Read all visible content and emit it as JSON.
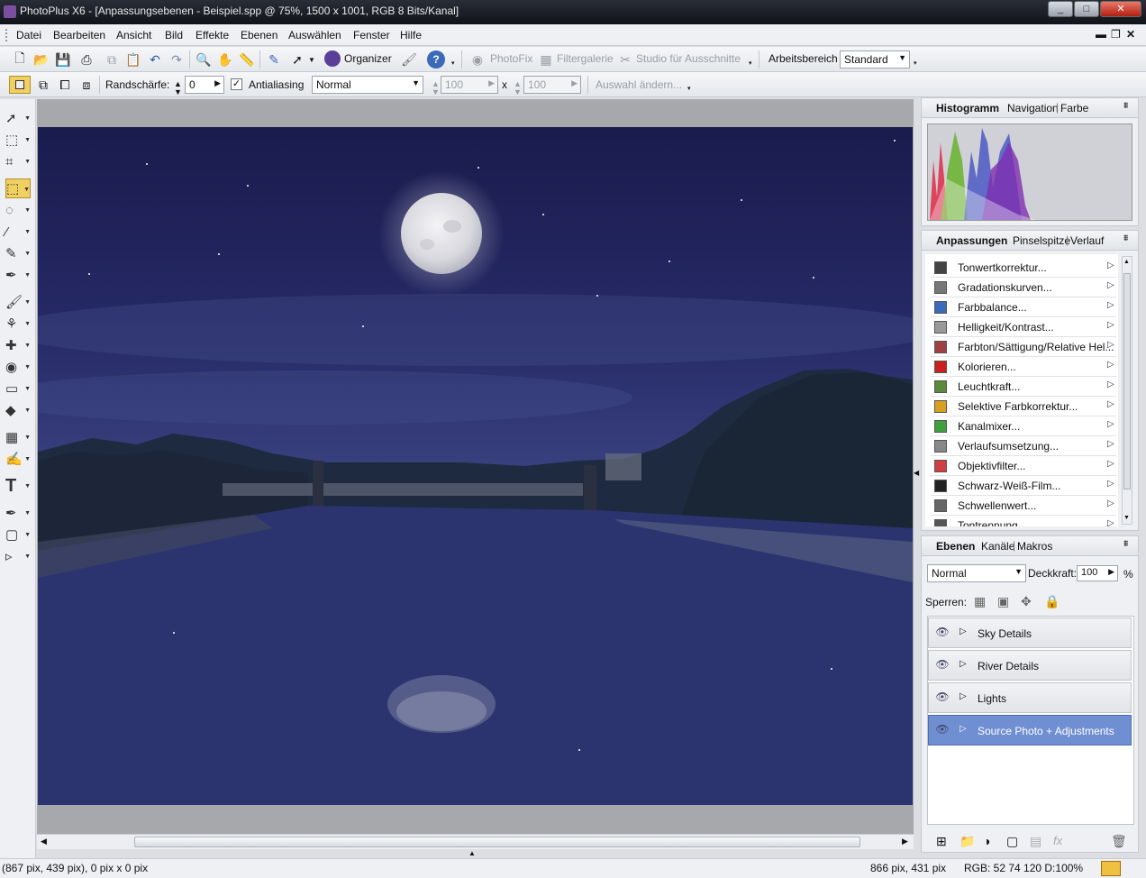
{
  "window": {
    "title": "PhotoPlus X6 - [Anpassungsebenen - Beispiel.spp @ 75%, 1500 x 1001, RGB 8 Bits/Kanal]",
    "controls": [
      "_",
      "□",
      "✕"
    ]
  },
  "menu": [
    "Datei",
    "Bearbeiten",
    "Ansicht",
    "Bild",
    "Effekte",
    "Ebenen",
    "Auswählen",
    "Fenster",
    "Hilfe"
  ],
  "toolbar1": {
    "organizer_label": "Organizer",
    "photofix_label": "PhotoFix",
    "filtergalerie_label": "Filtergalerie",
    "studio_label": "Studio für Ausschnitte",
    "workspace_label": "Arbeitsbereich",
    "workspace_value": "Standard"
  },
  "toolbar2": {
    "randschaerfe_label": "Randschärfe:",
    "randschaerfe_value": "0",
    "antialiasing_label": "Antialiasing",
    "antialiasing_checked": true,
    "mode_value": "Normal",
    "width_value": "100",
    "times": "x",
    "height_value": "100",
    "auswahl_label": "Auswahl ändern..."
  },
  "tools": [
    "move-tool-icon",
    "transform-tool-icon",
    "crop-tool-icon",
    "rect-selection-icon",
    "lasso-icon",
    "magic-wand-icon",
    "selection-brush-icon",
    "color-picker-icon",
    "paintbrush-icon",
    "clone-icon",
    "patch-icon",
    "red-eye-icon",
    "eraser-icon",
    "fill-icon",
    "mesh-warp-icon",
    "smudge-icon",
    "text-icon",
    "pen-icon",
    "shape-icon",
    "node-edit-icon"
  ],
  "histogram_panel": {
    "tabs": [
      "Histogramm",
      "Navigation",
      "Farbe"
    ],
    "active_tab": "Histogramm"
  },
  "adjustments_panel": {
    "tabs": [
      "Anpassungen",
      "Pinselspitze",
      "Verlauf"
    ],
    "active_tab": "Anpassungen",
    "items": [
      {
        "label": "Tonwertkorrektur...",
        "icon": "levels-icon",
        "color": "#444444"
      },
      {
        "label": "Gradationskurven...",
        "icon": "curves-icon",
        "color": "#777777"
      },
      {
        "label": "Farbbalance...",
        "icon": "color-balance-icon",
        "color": "#3a6ab8"
      },
      {
        "label": "Helligkeit/Kontrast...",
        "icon": "brightness-icon",
        "color": "#999999"
      },
      {
        "label": "Farbton/Sättigung/Relative Hel...",
        "icon": "hue-saturation-icon",
        "color": "#a04040"
      },
      {
        "label": "Kolorieren...",
        "icon": "colorize-icon",
        "color": "#cc2020"
      },
      {
        "label": "Leuchtkraft...",
        "icon": "vibrance-icon",
        "color": "#5a8a3a"
      },
      {
        "label": "Selektive Farbkorrektur...",
        "icon": "selective-color-icon",
        "color": "#d8a020"
      },
      {
        "label": "Kanalmixer...",
        "icon": "channel-mixer-icon",
        "color": "#40a040"
      },
      {
        "label": "Verlaufsumsetzung...",
        "icon": "gradient-map-icon",
        "color": "#888888"
      },
      {
        "label": "Objektivfilter...",
        "icon": "lens-filter-icon",
        "color": "#d04040"
      },
      {
        "label": "Schwarz-Weiß-Film...",
        "icon": "black-white-icon",
        "color": "#222222"
      },
      {
        "label": "Schwellenwert...",
        "icon": "threshold-icon",
        "color": "#666666"
      },
      {
        "label": "Tontrennung...",
        "icon": "posterize-icon",
        "color": "#555555"
      }
    ]
  },
  "layers_panel": {
    "tabs": [
      "Ebenen",
      "Kanäle",
      "Makros"
    ],
    "active_tab": "Ebenen",
    "blend_mode": "Normal",
    "opacity_label": "Deckkraft:",
    "opacity_value": "100",
    "opacity_unit": "%",
    "lock_label": "Sperren:",
    "layers": [
      {
        "name": "Sky Details",
        "selected": false
      },
      {
        "name": "River Details",
        "selected": false
      },
      {
        "name": "Lights",
        "selected": false
      },
      {
        "name": "Source Photo + Adjustments",
        "selected": true
      }
    ]
  },
  "statusbar": {
    "left": "(867 pix, 439 pix), 0 pix x 0 pix",
    "mid": "866 pix, 431 pix",
    "right": "RGB: 52 74 120 D:100%"
  },
  "colors": {
    "accent": "#6f8fd2",
    "sky": "#262a66",
    "water": "#2e3672"
  }
}
